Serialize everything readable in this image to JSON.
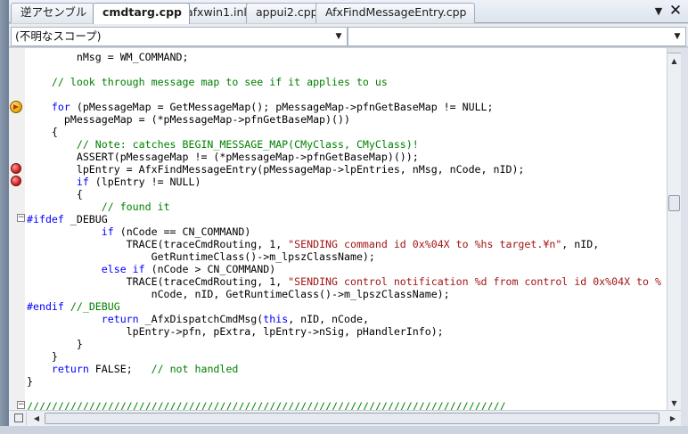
{
  "tabs": [
    {
      "label": "逆アセンブル",
      "active": false
    },
    {
      "label": "cmdtarg.cpp",
      "active": true
    },
    {
      "label": "afxwin1.inl",
      "active": false
    },
    {
      "label": "appui2.cpp",
      "active": false
    },
    {
      "label": "AfxFindMessageEntry.cpp",
      "active": false
    }
  ],
  "tab_controls": {
    "menu_icon": "▼",
    "close_icon": "✕"
  },
  "navbar": {
    "scope_combo": "(不明なスコープ)",
    "member_combo": ""
  },
  "code_lines": [
    [
      {
        "t": "        nMsg = WM_COMMAND;"
      }
    ],
    [],
    [
      {
        "t": "    // look through message map to see if it applies to us",
        "c": "cm"
      }
    ],
    [],
    [
      {
        "t": "    "
      },
      {
        "t": "for",
        "c": "kw"
      },
      {
        "t": " (pMessageMap = GetMessageMap(); pMessageMap->pfnGetBaseMap != NULL;"
      }
    ],
    [
      {
        "t": "      pMessageMap = (*pMessageMap->pfnGetBaseMap)())"
      }
    ],
    [
      {
        "t": "    {"
      }
    ],
    [
      {
        "t": "        "
      },
      {
        "t": "// Note: catches BEGIN_MESSAGE_MAP(CMyClass, CMyClass)!",
        "c": "cm"
      }
    ],
    [
      {
        "t": "        ASSERT(pMessageMap != (*pMessageMap->pfnGetBaseMap)());"
      }
    ],
    [
      {
        "t": "        lpEntry = AfxFindMessageEntry(pMessageMap->lpEntries, nMsg, nCode, nID);"
      }
    ],
    [
      {
        "t": "        "
      },
      {
        "t": "if",
        "c": "kw"
      },
      {
        "t": " (lpEntry != NULL)"
      }
    ],
    [
      {
        "t": "        {"
      }
    ],
    [
      {
        "t": "            "
      },
      {
        "t": "// found it",
        "c": "cm"
      }
    ],
    [
      {
        "t": "#ifdef",
        "c": "pp"
      },
      {
        "t": " _DEBUG"
      }
    ],
    [
      {
        "t": "            "
      },
      {
        "t": "if",
        "c": "kw"
      },
      {
        "t": " (nCode == CN_COMMAND)"
      }
    ],
    [
      {
        "t": "                TRACE(traceCmdRouting, 1, "
      },
      {
        "t": "\"SENDING command id 0x%04X to %hs target.¥n\"",
        "c": "st"
      },
      {
        "t": ", nID,"
      }
    ],
    [
      {
        "t": "                    GetRuntimeClass()->m_lpszClassName);"
      }
    ],
    [
      {
        "t": "            "
      },
      {
        "t": "else if",
        "c": "kw"
      },
      {
        "t": " (nCode > CN_COMMAND)"
      }
    ],
    [
      {
        "t": "                TRACE(traceCmdRouting, 1, "
      },
      {
        "t": "\"SENDING control notification %d from control id 0x%04X to %",
        "c": "st"
      }
    ],
    [
      {
        "t": "                    nCode, nID, GetRuntimeClass()->m_lpszClassName);"
      }
    ],
    [
      {
        "t": "#endif",
        "c": "pp"
      },
      {
        "t": " "
      },
      {
        "t": "//_DEBUG",
        "c": "cm"
      }
    ],
    [
      {
        "t": "            "
      },
      {
        "t": "return",
        "c": "kw"
      },
      {
        "t": " _AfxDispatchCmdMsg("
      },
      {
        "t": "this",
        "c": "kw"
      },
      {
        "t": ", nID, nCode,"
      }
    ],
    [
      {
        "t": "                lpEntry->pfn, pExtra, lpEntry->nSig, pHandlerInfo);"
      }
    ],
    [
      {
        "t": "        }"
      }
    ],
    [
      {
        "t": "    }"
      }
    ],
    [
      {
        "t": "    "
      },
      {
        "t": "return",
        "c": "kw"
      },
      {
        "t": " FALSE;   "
      },
      {
        "t": "// not handled",
        "c": "cm"
      }
    ],
    [
      {
        "t": "}"
      }
    ],
    [],
    [
      {
        "t": "/////////////////////////////////////////////////////////////////////////////",
        "c": "cm"
      }
    ]
  ],
  "markers": {
    "current_line_icon": "current-statement-arrow-icon",
    "breakpoint_icon": "breakpoint-icon"
  },
  "scroll": {
    "up_arrow": "▲",
    "down_arrow": "▼",
    "left_arrow": "◀",
    "right_arrow": "▶"
  }
}
